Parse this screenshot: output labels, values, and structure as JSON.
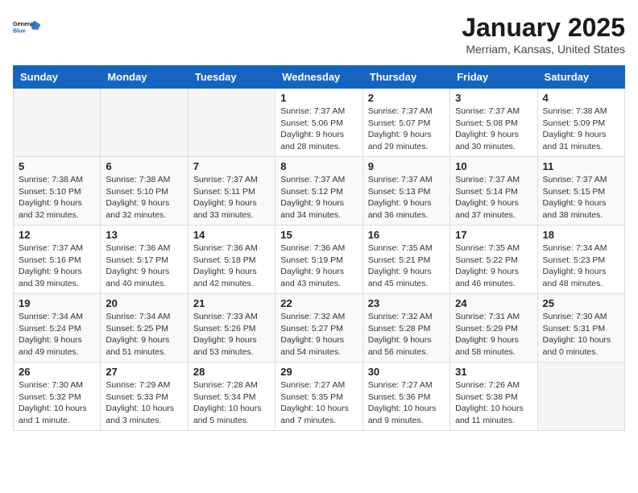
{
  "logo": {
    "line1": "General",
    "line2": "Blue"
  },
  "title": "January 2025",
  "location": "Merriam, Kansas, United States",
  "days_of_week": [
    "Sunday",
    "Monday",
    "Tuesday",
    "Wednesday",
    "Thursday",
    "Friday",
    "Saturday"
  ],
  "weeks": [
    [
      {
        "day": "",
        "info": ""
      },
      {
        "day": "",
        "info": ""
      },
      {
        "day": "",
        "info": ""
      },
      {
        "day": "1",
        "info": "Sunrise: 7:37 AM\nSunset: 5:06 PM\nDaylight: 9 hours\nand 28 minutes."
      },
      {
        "day": "2",
        "info": "Sunrise: 7:37 AM\nSunset: 5:07 PM\nDaylight: 9 hours\nand 29 minutes."
      },
      {
        "day": "3",
        "info": "Sunrise: 7:37 AM\nSunset: 5:08 PM\nDaylight: 9 hours\nand 30 minutes."
      },
      {
        "day": "4",
        "info": "Sunrise: 7:38 AM\nSunset: 5:09 PM\nDaylight: 9 hours\nand 31 minutes."
      }
    ],
    [
      {
        "day": "5",
        "info": "Sunrise: 7:38 AM\nSunset: 5:10 PM\nDaylight: 9 hours\nand 32 minutes."
      },
      {
        "day": "6",
        "info": "Sunrise: 7:38 AM\nSunset: 5:10 PM\nDaylight: 9 hours\nand 32 minutes."
      },
      {
        "day": "7",
        "info": "Sunrise: 7:37 AM\nSunset: 5:11 PM\nDaylight: 9 hours\nand 33 minutes."
      },
      {
        "day": "8",
        "info": "Sunrise: 7:37 AM\nSunset: 5:12 PM\nDaylight: 9 hours\nand 34 minutes."
      },
      {
        "day": "9",
        "info": "Sunrise: 7:37 AM\nSunset: 5:13 PM\nDaylight: 9 hours\nand 36 minutes."
      },
      {
        "day": "10",
        "info": "Sunrise: 7:37 AM\nSunset: 5:14 PM\nDaylight: 9 hours\nand 37 minutes."
      },
      {
        "day": "11",
        "info": "Sunrise: 7:37 AM\nSunset: 5:15 PM\nDaylight: 9 hours\nand 38 minutes."
      }
    ],
    [
      {
        "day": "12",
        "info": "Sunrise: 7:37 AM\nSunset: 5:16 PM\nDaylight: 9 hours\nand 39 minutes."
      },
      {
        "day": "13",
        "info": "Sunrise: 7:36 AM\nSunset: 5:17 PM\nDaylight: 9 hours\nand 40 minutes."
      },
      {
        "day": "14",
        "info": "Sunrise: 7:36 AM\nSunset: 5:18 PM\nDaylight: 9 hours\nand 42 minutes."
      },
      {
        "day": "15",
        "info": "Sunrise: 7:36 AM\nSunset: 5:19 PM\nDaylight: 9 hours\nand 43 minutes."
      },
      {
        "day": "16",
        "info": "Sunrise: 7:35 AM\nSunset: 5:21 PM\nDaylight: 9 hours\nand 45 minutes."
      },
      {
        "day": "17",
        "info": "Sunrise: 7:35 AM\nSunset: 5:22 PM\nDaylight: 9 hours\nand 46 minutes."
      },
      {
        "day": "18",
        "info": "Sunrise: 7:34 AM\nSunset: 5:23 PM\nDaylight: 9 hours\nand 48 minutes."
      }
    ],
    [
      {
        "day": "19",
        "info": "Sunrise: 7:34 AM\nSunset: 5:24 PM\nDaylight: 9 hours\nand 49 minutes."
      },
      {
        "day": "20",
        "info": "Sunrise: 7:34 AM\nSunset: 5:25 PM\nDaylight: 9 hours\nand 51 minutes."
      },
      {
        "day": "21",
        "info": "Sunrise: 7:33 AM\nSunset: 5:26 PM\nDaylight: 9 hours\nand 53 minutes."
      },
      {
        "day": "22",
        "info": "Sunrise: 7:32 AM\nSunset: 5:27 PM\nDaylight: 9 hours\nand 54 minutes."
      },
      {
        "day": "23",
        "info": "Sunrise: 7:32 AM\nSunset: 5:28 PM\nDaylight: 9 hours\nand 56 minutes."
      },
      {
        "day": "24",
        "info": "Sunrise: 7:31 AM\nSunset: 5:29 PM\nDaylight: 9 hours\nand 58 minutes."
      },
      {
        "day": "25",
        "info": "Sunrise: 7:30 AM\nSunset: 5:31 PM\nDaylight: 10 hours\nand 0 minutes."
      }
    ],
    [
      {
        "day": "26",
        "info": "Sunrise: 7:30 AM\nSunset: 5:32 PM\nDaylight: 10 hours\nand 1 minute."
      },
      {
        "day": "27",
        "info": "Sunrise: 7:29 AM\nSunset: 5:33 PM\nDaylight: 10 hours\nand 3 minutes."
      },
      {
        "day": "28",
        "info": "Sunrise: 7:28 AM\nSunset: 5:34 PM\nDaylight: 10 hours\nand 5 minutes."
      },
      {
        "day": "29",
        "info": "Sunrise: 7:27 AM\nSunset: 5:35 PM\nDaylight: 10 hours\nand 7 minutes."
      },
      {
        "day": "30",
        "info": "Sunrise: 7:27 AM\nSunset: 5:36 PM\nDaylight: 10 hours\nand 9 minutes."
      },
      {
        "day": "31",
        "info": "Sunrise: 7:26 AM\nSunset: 5:38 PM\nDaylight: 10 hours\nand 11 minutes."
      },
      {
        "day": "",
        "info": ""
      }
    ]
  ]
}
